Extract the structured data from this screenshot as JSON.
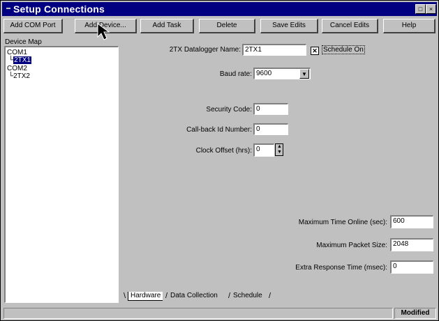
{
  "window": {
    "title": "Setup Connections",
    "title_buttons": [
      "_",
      "□",
      "×"
    ]
  },
  "toolbar": {
    "add_com_port": "Add COM Port",
    "add_device": "Add Device...",
    "add_task": "Add Task",
    "delete": "Delete",
    "save_edits": "Save Edits",
    "cancel_edits": "Cancel Edits",
    "help": "Help"
  },
  "device_map": {
    "label": "Device Map",
    "items": [
      {
        "label": "COM1",
        "selected": false
      },
      {
        "label": "2TX1",
        "selected": true
      },
      {
        "label": "COM2",
        "selected": false
      },
      {
        "label": "2TX2",
        "selected": false
      }
    ]
  },
  "form": {
    "name_label": "2TX Datalogger Name:",
    "name_value": "2TX1",
    "schedule_on_label": "Schedule On",
    "schedule_on_checked": "✕",
    "baud_label": "Baud rate:",
    "baud_value": "9600",
    "security_label": "Security Code:",
    "security_value": "0",
    "callback_label": "Call-back Id Number:",
    "callback_value": "0",
    "clock_label": "Clock Offset (hrs):",
    "clock_value": "0",
    "max_online_label": "Maximum Time Online (sec):",
    "max_online_value": "600",
    "max_packet_label": "Maximum Packet Size:",
    "max_packet_value": "2048",
    "extra_response_label": "Extra Response Time (msec):",
    "extra_response_value": "0"
  },
  "tabs": [
    "Hardware",
    "Data Collection",
    "Schedule"
  ],
  "status": {
    "state": "Modified"
  },
  "icons": {
    "combo": "chevron-down-icon",
    "spin_up": "spin-up-icon",
    "spin_down": "spin-down-icon",
    "cursor": "mouse-pointer-icon"
  }
}
